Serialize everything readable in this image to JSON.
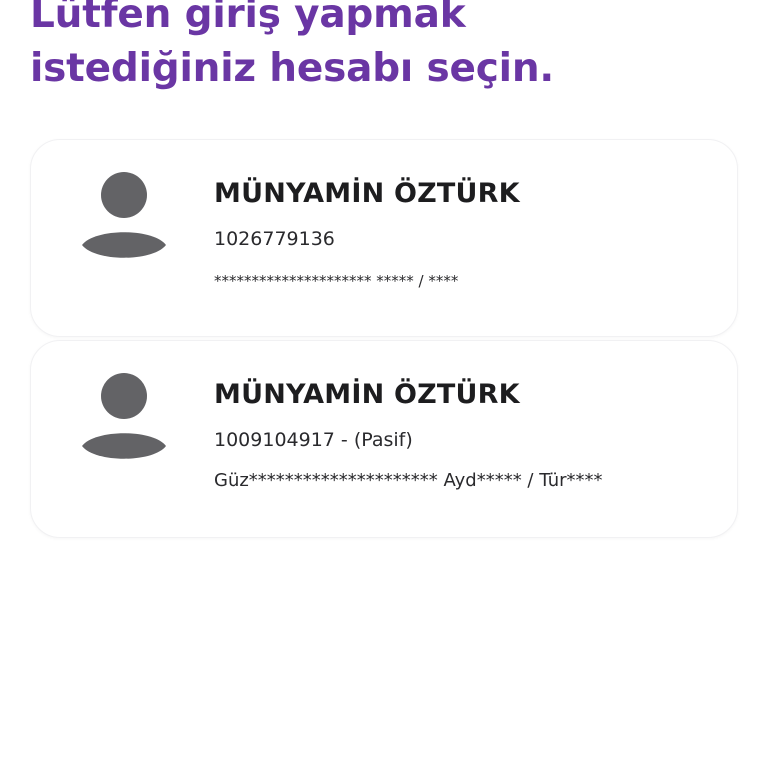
{
  "header": {
    "title_line1": "Lütfen giriş yapmak",
    "title_line2": "istediğiniz hesabı seçin."
  },
  "accounts": [
    {
      "avatar_icon": "user-icon",
      "name": "MÜNYAMİN ÖZTÜRK",
      "number": "1026779136",
      "masked_info": "********************* ***** / ****"
    },
    {
      "avatar_icon": "user-icon",
      "name": "MÜNYAMİN ÖZTÜRK",
      "number": "1009104917 - (Pasif)",
      "masked_info": "Güz********************* Ayd***** / Tür****"
    }
  ],
  "colors": {
    "title": "#6a36a4",
    "avatar": "#636366",
    "text": "#1d1d1f"
  }
}
